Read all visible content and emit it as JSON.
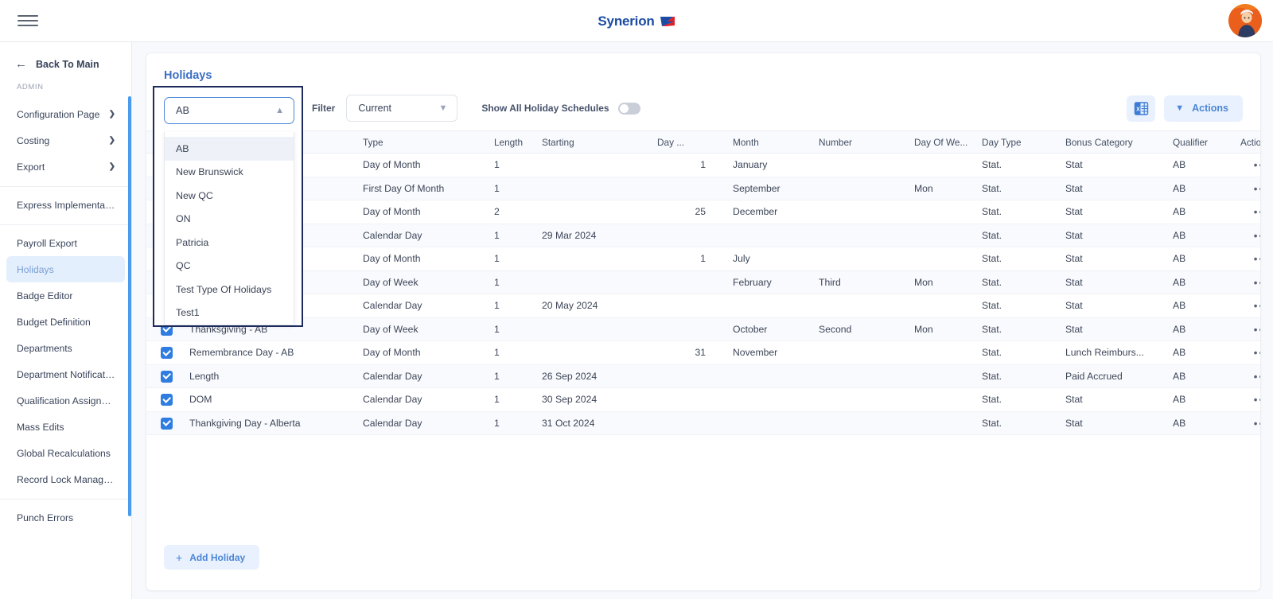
{
  "topbar": {
    "menu_icon": "hamburger-icon",
    "brand_text": "Synerion",
    "brand_mark_icon": "synerion-logo-mark",
    "avatar_icon": "user-avatar"
  },
  "sidebar": {
    "back_label": "Back To Main",
    "back_icon": "arrow-left-icon",
    "section_label": "ADMIN",
    "groups": [
      {
        "items": [
          {
            "label": "Configuration Page",
            "chevron": "❯",
            "active": false
          },
          {
            "label": "Costing",
            "chevron": "❯",
            "active": false
          },
          {
            "label": "Export",
            "chevron": "❯",
            "active": false
          }
        ]
      },
      {
        "items": [
          {
            "label": "Express Implementation P...",
            "chevron": "",
            "active": false
          }
        ]
      },
      {
        "items": [
          {
            "label": "Payroll Export",
            "chevron": "",
            "active": false
          },
          {
            "label": "Holidays",
            "chevron": "",
            "active": true
          },
          {
            "label": "Badge Editor",
            "chevron": "",
            "active": false
          },
          {
            "label": "Budget Definition",
            "chevron": "",
            "active": false
          },
          {
            "label": "Departments",
            "chevron": "",
            "active": false
          },
          {
            "label": "Department Notifications",
            "chevron": "",
            "active": false
          },
          {
            "label": "Qualification Assignments",
            "chevron": "",
            "active": false
          },
          {
            "label": "Mass Edits",
            "chevron": "",
            "active": false
          },
          {
            "label": "Global Recalculations",
            "chevron": "",
            "active": false
          },
          {
            "label": "Record Lock Management",
            "chevron": "",
            "active": false
          }
        ]
      },
      {
        "items": [
          {
            "label": "Punch Errors",
            "chevron": "",
            "active": false
          }
        ]
      }
    ]
  },
  "page": {
    "title": "Holidays"
  },
  "toolbar": {
    "schedule_select_value": "AB",
    "filter_label": "Filter",
    "filter_select_value": "Current",
    "toggle_label": "Show All Holiday Schedules",
    "toggle_state": "off",
    "export_icon": "excel-export-icon",
    "actions_label": "Actions",
    "actions_chevron_icon": "chevron-down-icon"
  },
  "dropdown": {
    "open": true,
    "field_value": "AB",
    "caret_icon": "chevron-up-icon",
    "options": [
      {
        "label": "AB",
        "selected": true
      },
      {
        "label": "New Brunswick",
        "selected": false
      },
      {
        "label": "New QC",
        "selected": false
      },
      {
        "label": "ON",
        "selected": false
      },
      {
        "label": "Patricia",
        "selected": false
      },
      {
        "label": "QC",
        "selected": false
      },
      {
        "label": "Test Type Of Holidays",
        "selected": false
      },
      {
        "label": "Test1",
        "selected": false
      }
    ]
  },
  "table": {
    "columns": [
      {
        "key": "chk",
        "label": "",
        "cls": "c-chk"
      },
      {
        "key": "name",
        "label": "",
        "cls": "c-name"
      },
      {
        "key": "type",
        "label": "Type",
        "cls": "c-type"
      },
      {
        "key": "len",
        "label": "Length",
        "cls": "c-len"
      },
      {
        "key": "start",
        "label": "Starting",
        "cls": "c-start"
      },
      {
        "key": "day",
        "label": "Day ...",
        "cls": "c-day"
      },
      {
        "key": "month",
        "label": "Month",
        "cls": "c-mon"
      },
      {
        "key": "num",
        "label": "Number",
        "cls": "c-num"
      },
      {
        "key": "dow",
        "label": "Day Of We...",
        "cls": "c-dow"
      },
      {
        "key": "dtype",
        "label": "Day Type",
        "cls": "c-dtyp"
      },
      {
        "key": "bonus",
        "label": "Bonus Category",
        "cls": "c-bon"
      },
      {
        "key": "qual",
        "label": "Qualifier",
        "cls": "c-qual"
      },
      {
        "key": "act",
        "label": "Actions",
        "cls": "c-act"
      }
    ],
    "rows": [
      {
        "checked": true,
        "name": "",
        "type": "Day of Month",
        "len": "1",
        "start": "",
        "day": "1",
        "month": "January",
        "num": "",
        "dow": "",
        "dtype": "Stat.",
        "bonus": "Stat",
        "qual": "AB",
        "act": "•••"
      },
      {
        "checked": true,
        "name": "",
        "type": "First Day Of Month",
        "len": "1",
        "start": "",
        "day": "",
        "month": "September",
        "num": "",
        "dow": "Mon",
        "dtype": "Stat.",
        "bonus": "Stat",
        "qual": "AB",
        "act": "•••"
      },
      {
        "checked": true,
        "name": "",
        "type": "Day of Month",
        "len": "2",
        "start": "",
        "day": "25",
        "month": "December",
        "num": "",
        "dow": "",
        "dtype": "Stat.",
        "bonus": "Stat",
        "qual": "AB",
        "act": "•••"
      },
      {
        "checked": true,
        "name": "",
        "type": "Calendar Day",
        "len": "1",
        "start": "29 Mar 2024",
        "day": "",
        "month": "",
        "num": "",
        "dow": "",
        "dtype": "Stat.",
        "bonus": "Stat",
        "qual": "AB",
        "act": "•••"
      },
      {
        "checked": true,
        "name": "",
        "type": "Day of Month",
        "len": "1",
        "start": "",
        "day": "1",
        "month": "July",
        "num": "",
        "dow": "",
        "dtype": "Stat.",
        "bonus": "Stat",
        "qual": "AB",
        "act": "•••"
      },
      {
        "checked": true,
        "name": "",
        "type": "Day of Week",
        "len": "1",
        "start": "",
        "day": "",
        "month": "February",
        "num": "Third",
        "dow": "Mon",
        "dtype": "Stat.",
        "bonus": "Stat",
        "qual": "AB",
        "act": "•••"
      },
      {
        "checked": true,
        "name": "",
        "type": "Calendar Day",
        "len": "1",
        "start": "20 May 2024",
        "day": "",
        "month": "",
        "num": "",
        "dow": "",
        "dtype": "Stat.",
        "bonus": "Stat",
        "qual": "AB",
        "act": "•••"
      },
      {
        "checked": true,
        "name": "Thanksgiving - AB",
        "type": "Day of Week",
        "len": "1",
        "start": "",
        "day": "",
        "month": "October",
        "num": "Second",
        "dow": "Mon",
        "dtype": "Stat.",
        "bonus": "Stat",
        "qual": "AB",
        "act": "•••"
      },
      {
        "checked": true,
        "name": "Remembrance Day - AB",
        "type": "Day of Month",
        "len": "1",
        "start": "",
        "day": "31",
        "month": "November",
        "num": "",
        "dow": "",
        "dtype": "Stat.",
        "bonus": "Lunch Reimburs...",
        "qual": "AB",
        "act": "•••"
      },
      {
        "checked": true,
        "name": "Length",
        "type": "Calendar Day",
        "len": "1",
        "start": "26 Sep 2024",
        "day": "",
        "month": "",
        "num": "",
        "dow": "",
        "dtype": "Stat.",
        "bonus": "Paid Accrued",
        "qual": "AB",
        "act": "•••"
      },
      {
        "checked": true,
        "name": "DOM",
        "type": "Calendar Day",
        "len": "1",
        "start": "30 Sep 2024",
        "day": "",
        "month": "",
        "num": "",
        "dow": "",
        "dtype": "Stat.",
        "bonus": "Stat",
        "qual": "AB",
        "act": "•••"
      },
      {
        "checked": true,
        "name": "Thankgiving Day - Alberta",
        "type": "Calendar Day",
        "len": "1",
        "start": "31 Oct 2024",
        "day": "",
        "month": "",
        "num": "",
        "dow": "",
        "dtype": "Stat.",
        "bonus": "Stat",
        "qual": "AB",
        "act": "•••"
      }
    ]
  },
  "footer": {
    "add_label": "Add Holiday",
    "add_icon": "plus-icon"
  },
  "colors": {
    "brand_blue": "#1b4ba3",
    "accent_blue": "#4d86d6",
    "panel_bg": "#f7f9fc",
    "active_nav_bg": "#e3effc",
    "checkbox_blue": "#2f7de1",
    "dropdown_outline": "#1c2a5e",
    "scrollbar_blue": "#4a9bed"
  }
}
